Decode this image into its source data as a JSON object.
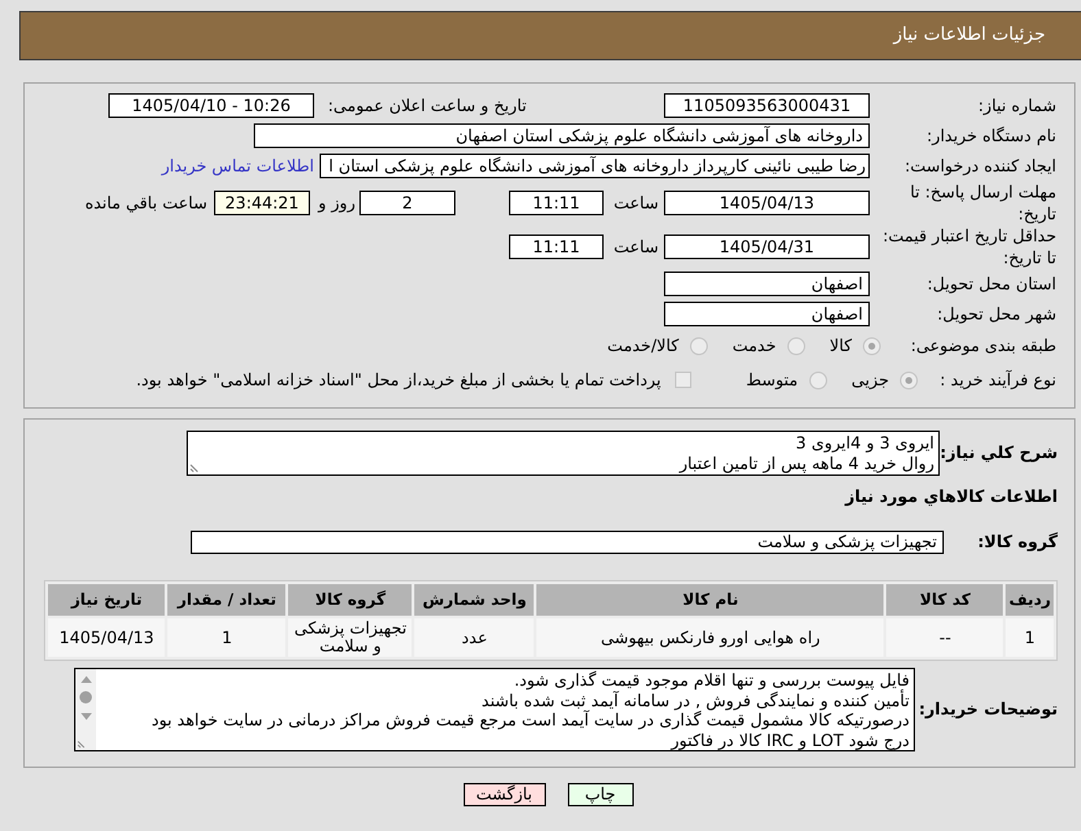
{
  "title_bar": {
    "title": "جزئیات اطلاعات نیاز"
  },
  "details": {
    "need_number": {
      "label": "شماره نیاز:",
      "value": "1105093563000431"
    },
    "announcement": {
      "label": "تاریخ و ساعت اعلان عمومی:",
      "value": "1405/04/10 - 10:26"
    },
    "buyer_org": {
      "label": "نام دستگاه خریدار:",
      "value": "داروخانه های آموزشی دانشگاه علوم پزشکی استان اصفهان"
    },
    "requester": {
      "label": "ایجاد کننده درخواست:",
      "value": "رضا طیبی نائینی کارپرداز داروخانه های آموزشی دانشگاه علوم پزشکی استان ا",
      "contact_link": "اطلاعات تماس خریدار"
    },
    "response_deadline": {
      "label": "مهلت ارسال پاسخ: تا تاریخ:",
      "date": "1405/04/13",
      "time_label": "ساعت",
      "time": "11:11",
      "days": "2",
      "days_label": "روز و",
      "remaining_time": "23:44:21",
      "remaining_label": "ساعت باقي مانده"
    },
    "price_validity": {
      "label": "حداقل تاریخ اعتبار قیمت: تا تاریخ:",
      "date": "1405/04/31",
      "time_label": "ساعت",
      "time": "11:11"
    },
    "delivery_province": {
      "label": "استان محل تحویل:",
      "value": "اصفهان"
    },
    "delivery_city": {
      "label": "شهر محل تحویل:",
      "value": "اصفهان"
    },
    "subject_category": {
      "label": "طبقه بندی موضوعی:",
      "options": [
        {
          "label": "کالا",
          "selected": true,
          "disabled": true
        },
        {
          "label": "خدمت",
          "selected": false,
          "disabled": true
        },
        {
          "label": "کالا/خدمت",
          "selected": false,
          "disabled": true
        }
      ]
    },
    "purchase_process": {
      "label": "نوع فرآیند خرید :",
      "options": [
        {
          "label": "جزیی",
          "selected": true,
          "disabled": true
        },
        {
          "label": "متوسط",
          "selected": false,
          "disabled": true
        }
      ],
      "treasury_payment": {
        "label": "پرداخت تمام یا بخشی از مبلغ خرید،از محل \"اسناد خزانه اسلامی\" خواهد بود.",
        "checked": false,
        "disabled": true
      }
    }
  },
  "need": {
    "description": {
      "label": "شرح کلي نياز:",
      "lines": [
        "ایروی 3 و 4ایروی 3",
        "روال خرید 4 ماهه پس از تامین اعتبار"
      ]
    },
    "goods_heading": "اطلاعات کالاهاي مورد نياز",
    "goods_group": {
      "label": "گروه کالا:",
      "value": "تجهیزات پزشکی و سلامت"
    },
    "table": {
      "columns": [
        "ردیف",
        "کد کالا",
        "نام کالا",
        "واحد شمارش",
        "گروه کالا",
        "تعداد / مقدار",
        "تاریخ نیاز"
      ],
      "rows": [
        [
          "1",
          "--",
          "راه هوایی اورو فارنکس بیهوشی",
          "عدد",
          "تجهیزات پزشکی و سلامت",
          "1",
          "1405/04/13"
        ]
      ]
    },
    "buyer_notes": {
      "label": "توضیحات خریدار:",
      "lines": [
        "فایل پیوست بررسی و تنها اقلام موجود قیمت گذاری شود.",
        "تأمین کننده و نمایندگی فروش , در سامانه آیمد ثبت شده باشند",
        "درصورتیکه کالا مشمول قیمت گذاری در سایت آیمد است مرجع قیمت فروش مراکز درمانی در سایت خواهد بود",
        "درج شود LOT و IRC کالا در فاکتور"
      ]
    }
  },
  "buttons": [
    {
      "kind": "print",
      "label": "چاپ"
    },
    {
      "kind": "back",
      "label": "بازگشت"
    }
  ]
}
